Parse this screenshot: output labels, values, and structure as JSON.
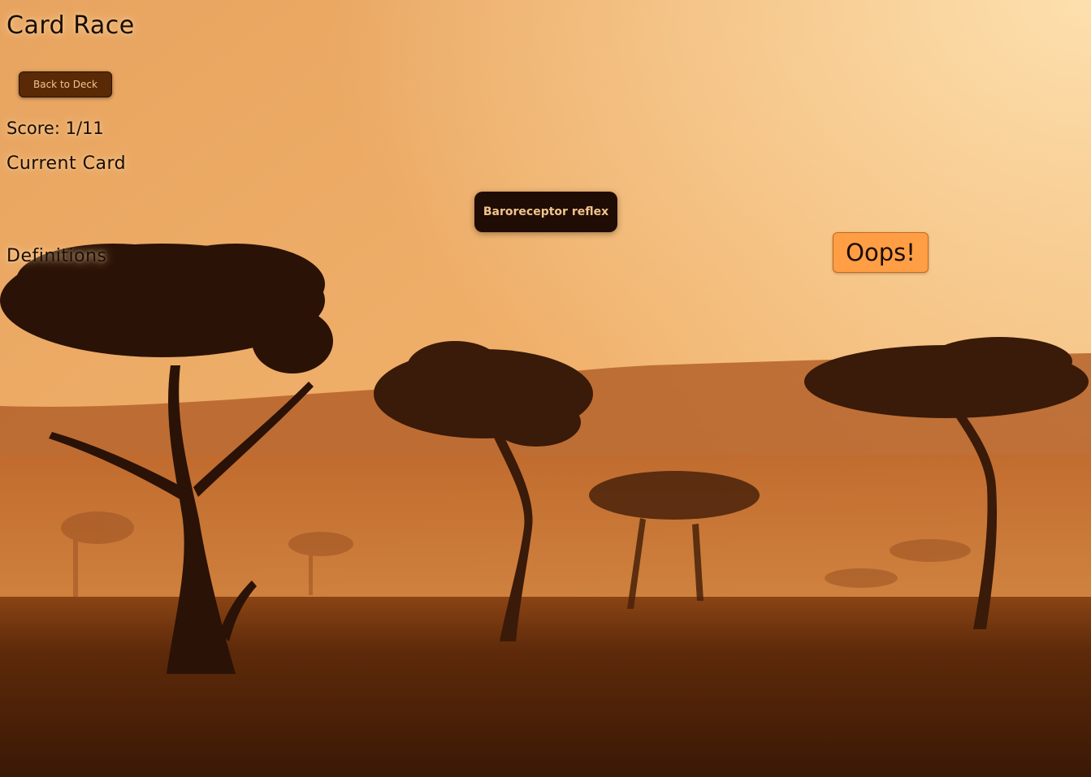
{
  "page": {
    "title": "Card Race"
  },
  "controls": {
    "back_label": "Back to Deck"
  },
  "score": {
    "label": "Score: ",
    "value": "1/11"
  },
  "current_card": {
    "heading": "Current Card",
    "term": "Baroreceptor reflex"
  },
  "definitions": {
    "heading": "Definitions"
  },
  "feedback": {
    "message": "Oops!"
  },
  "colors": {
    "sky_top": "#f5c98a",
    "sky_bottom": "#d97a2a",
    "ground": "#4a2008",
    "button_bg": "#5a2a06",
    "card_bg": "#1f0c05",
    "feedback_bg": "#ff9e45"
  }
}
